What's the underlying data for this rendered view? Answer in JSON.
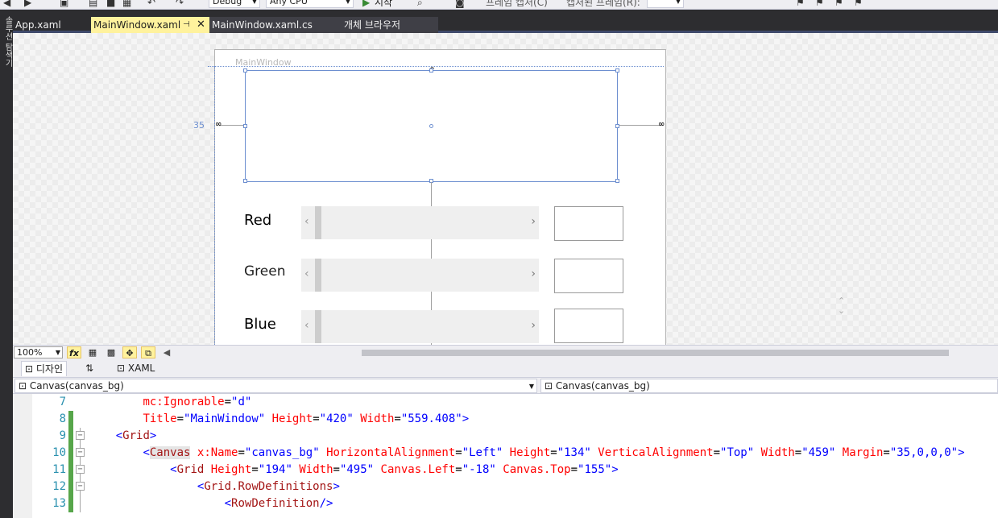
{
  "toolbar": {
    "config_value": "Debug",
    "platform_value": "Any CPU",
    "start_label": "시작",
    "capture_frame_label": "프레임 캡처(C)",
    "captured_frame_label": "캡처된 프레임(R):"
  },
  "left_rail": {
    "label": "솔루션 탐색기"
  },
  "tabs": [
    {
      "label": "App.xaml",
      "active": false
    },
    {
      "label": "MainWindow.xaml",
      "active": true
    },
    {
      "label": "MainWindow.xaml.cs",
      "active": false
    },
    {
      "label": "개체 브라우저",
      "active": false
    }
  ],
  "designer": {
    "window_title": "MainWindow",
    "margin_value": "35",
    "rows": [
      {
        "label": "Red"
      },
      {
        "label": "Green"
      },
      {
        "label": "Blue"
      }
    ]
  },
  "designer_bar": {
    "zoom": "100%",
    "fx_label": "fx"
  },
  "split": {
    "design_tab": "디자인",
    "swap_label": "⇅",
    "xaml_tab": "XAML"
  },
  "nav": {
    "left_element": "Canvas(canvas_bg)",
    "right_element": "Canvas(canvas_bg)"
  },
  "editor": {
    "lines": [
      {
        "num": "7",
        "indent": 8,
        "tokens": [
          [
            "attr",
            "mc:Ignorable"
          ],
          [
            "plain",
            "="
          ],
          [
            "val",
            "\"d\""
          ]
        ]
      },
      {
        "num": "8",
        "indent": 8,
        "tokens": [
          [
            "attr",
            "Title"
          ],
          [
            "plain",
            "="
          ],
          [
            "val",
            "\"MainWindow\""
          ],
          [
            "plain",
            " "
          ],
          [
            "attr",
            "Height"
          ],
          [
            "plain",
            "="
          ],
          [
            "val",
            "\"420\""
          ],
          [
            "plain",
            " "
          ],
          [
            "attr",
            "Width"
          ],
          [
            "plain",
            "="
          ],
          [
            "val",
            "\"559.408\""
          ],
          [
            "br",
            ">"
          ]
        ]
      },
      {
        "num": "9",
        "indent": 4,
        "tokens": [
          [
            "br",
            "<"
          ],
          [
            "tag",
            "Grid"
          ],
          [
            "br",
            ">"
          ]
        ]
      },
      {
        "num": "10",
        "indent": 8,
        "tokens": [
          [
            "br",
            "<"
          ],
          [
            "tag",
            "Canvas"
          ],
          [
            "plain",
            " "
          ],
          [
            "attr",
            "x:Name"
          ],
          [
            "plain",
            "="
          ],
          [
            "val",
            "\"canvas_bg\""
          ],
          [
            "plain",
            " "
          ],
          [
            "attr",
            "HorizontalAlignment"
          ],
          [
            "plain",
            "="
          ],
          [
            "val",
            "\"Left\""
          ],
          [
            "plain",
            " "
          ],
          [
            "attr",
            "Height"
          ],
          [
            "plain",
            "="
          ],
          [
            "val",
            "\"134\""
          ],
          [
            "plain",
            " "
          ],
          [
            "attr",
            "VerticalAlignment"
          ],
          [
            "plain",
            "="
          ],
          [
            "val",
            "\"Top\""
          ],
          [
            "plain",
            " "
          ],
          [
            "attr",
            "Width"
          ],
          [
            "plain",
            "="
          ],
          [
            "val",
            "\"459\""
          ],
          [
            "plain",
            " "
          ],
          [
            "attr",
            "Margin"
          ],
          [
            "plain",
            "="
          ],
          [
            "val",
            "\"35,0,0,0\""
          ],
          [
            "br",
            ">"
          ]
        ]
      },
      {
        "num": "11",
        "indent": 12,
        "tokens": [
          [
            "br",
            "<"
          ],
          [
            "tag",
            "Grid"
          ],
          [
            "plain",
            " "
          ],
          [
            "attr",
            "Height"
          ],
          [
            "plain",
            "="
          ],
          [
            "val",
            "\"194\""
          ],
          [
            "plain",
            " "
          ],
          [
            "attr",
            "Width"
          ],
          [
            "plain",
            "="
          ],
          [
            "val",
            "\"495\""
          ],
          [
            "plain",
            " "
          ],
          [
            "attr",
            "Canvas.Left"
          ],
          [
            "plain",
            "="
          ],
          [
            "val",
            "\"-18\""
          ],
          [
            "plain",
            " "
          ],
          [
            "attr",
            "Canvas.Top"
          ],
          [
            "plain",
            "="
          ],
          [
            "val",
            "\"155\""
          ],
          [
            "br",
            ">"
          ]
        ]
      },
      {
        "num": "12",
        "indent": 16,
        "tokens": [
          [
            "br",
            "<"
          ],
          [
            "tag",
            "Grid.RowDefinitions"
          ],
          [
            "br",
            ">"
          ]
        ]
      },
      {
        "num": "13",
        "indent": 20,
        "tokens": [
          [
            "br",
            "<"
          ],
          [
            "tag",
            "RowDefinition"
          ],
          [
            "br",
            "/>"
          ]
        ]
      }
    ]
  }
}
